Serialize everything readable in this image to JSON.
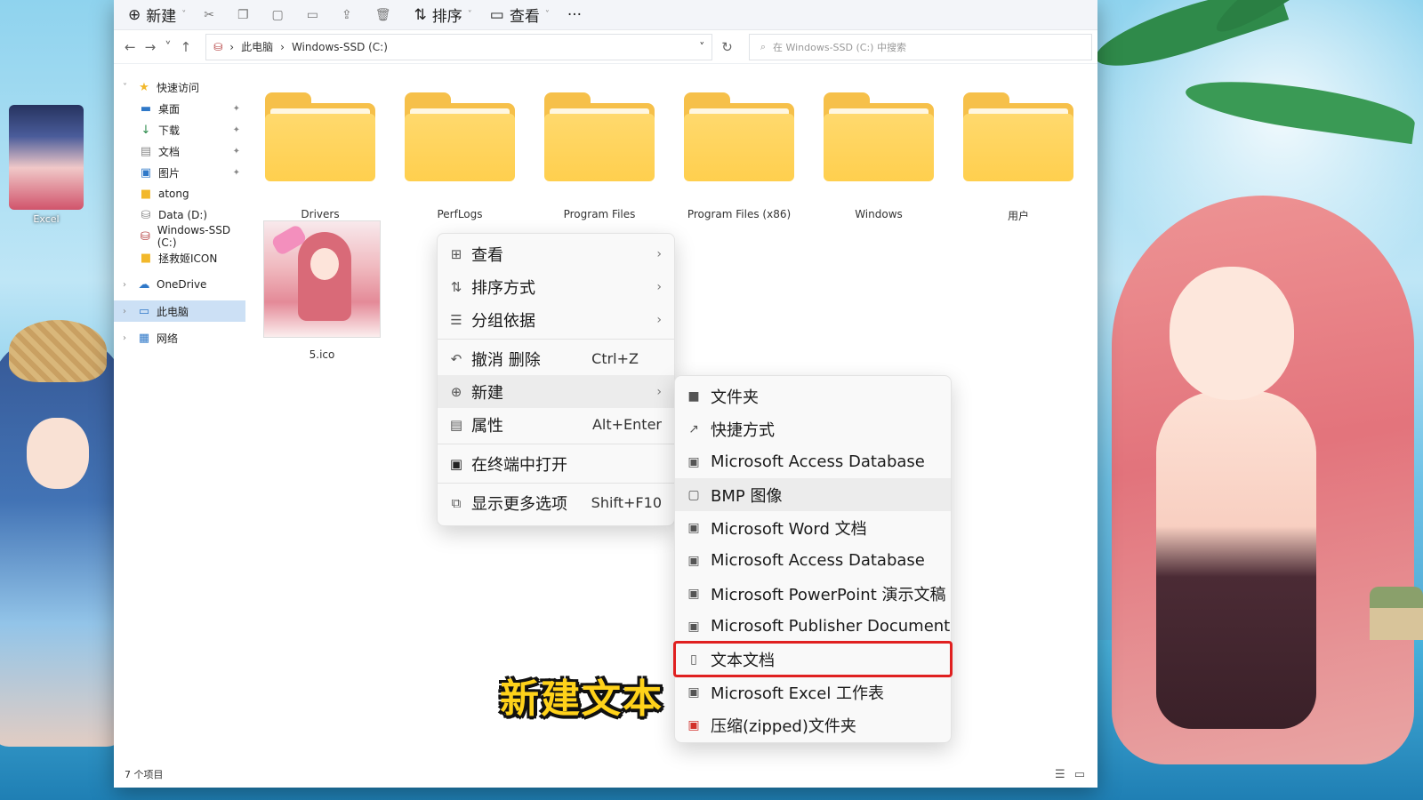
{
  "colors": {
    "accent": "#2f78c8",
    "folder": "#ffcf4e",
    "highlight": "#e02020",
    "caption": "#ffd21a",
    "selection": "#cce0f5"
  },
  "desktop": {
    "icon_label": "Excel"
  },
  "toolbar": {
    "new_label": "新建",
    "sort_label": "排序",
    "view_label": "查看",
    "more_label": "···"
  },
  "address": {
    "crumb_pc": "此电脑",
    "crumb_drive": "Windows-SSD (C:)",
    "search_placeholder": "在 Windows-SSD (C:) 中搜索"
  },
  "sidebar": {
    "items": [
      {
        "label": "快速访问",
        "icon": "star-icon"
      },
      {
        "label": "桌面",
        "icon": "desktop-icon"
      },
      {
        "label": "下载",
        "icon": "download-icon"
      },
      {
        "label": "文档",
        "icon": "document-icon"
      },
      {
        "label": "图片",
        "icon": "picture-icon"
      },
      {
        "label": "atong",
        "icon": "folder-icon"
      },
      {
        "label": "Data (D:)",
        "icon": "drive-icon"
      },
      {
        "label": "Windows-SSD (C:)",
        "icon": "drive-icon"
      },
      {
        "label": "拯救姬ICON",
        "icon": "folder-icon"
      },
      {
        "label": "OneDrive",
        "icon": "cloud-icon"
      },
      {
        "label": "此电脑",
        "icon": "computer-icon"
      },
      {
        "label": "网络",
        "icon": "network-icon"
      }
    ]
  },
  "files": {
    "folders": [
      "Drivers",
      "PerfLogs",
      "Program Files",
      "Program Files (x86)",
      "Windows",
      "用户"
    ],
    "ico_file": "5.ico"
  },
  "context_menu": {
    "view": "查看",
    "sort": "排序方式",
    "group": "分组依据",
    "undo": "撤消 删除",
    "undo_shortcut": "Ctrl+Z",
    "new": "新建",
    "properties": "属性",
    "properties_shortcut": "Alt+Enter",
    "terminal": "在终端中打开",
    "more_options": "显示更多选项",
    "more_options_shortcut": "Shift+F10"
  },
  "new_submenu": {
    "items": [
      {
        "label": "文件夹",
        "icon": "folder-icon"
      },
      {
        "label": "快捷方式",
        "icon": "shortcut-icon"
      },
      {
        "label": "Microsoft Access Database",
        "icon": "access-icon"
      },
      {
        "label": "BMP 图像",
        "icon": "bmp-icon"
      },
      {
        "label": "Microsoft Word 文档",
        "icon": "word-icon"
      },
      {
        "label": "Microsoft Access Database",
        "icon": "access-icon"
      },
      {
        "label": "Microsoft PowerPoint 演示文稿",
        "icon": "powerpoint-icon"
      },
      {
        "label": "Microsoft Publisher Document",
        "icon": "publisher-icon"
      },
      {
        "label": "文本文档",
        "icon": "text-document-icon"
      },
      {
        "label": "Microsoft Excel 工作表",
        "icon": "excel-icon"
      },
      {
        "label": "压缩(zipped)文件夹",
        "icon": "zip-icon"
      }
    ]
  },
  "caption": "新建文本",
  "status": {
    "item_count": "7 个项目"
  }
}
